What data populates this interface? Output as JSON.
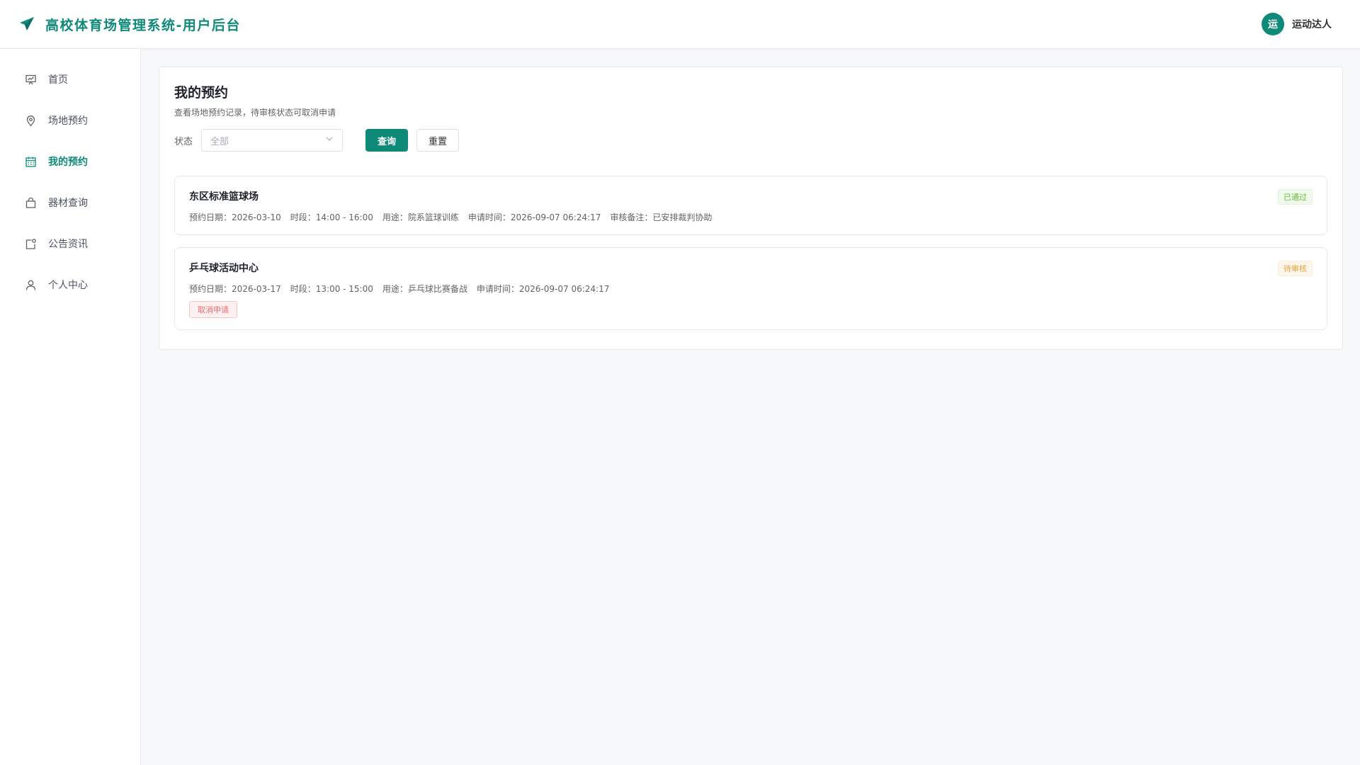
{
  "header": {
    "title": "高校体育场管理系统-用户后台",
    "logo_icon": "paper-plane-icon",
    "user": {
      "avatar_text": "运",
      "name": "运动达人"
    }
  },
  "sidebar": {
    "items": [
      {
        "label": "首页",
        "icon": "presentation-icon",
        "active": false
      },
      {
        "label": "场地预约",
        "icon": "location-pin-icon",
        "active": false
      },
      {
        "label": "我的预约",
        "icon": "calendar-icon",
        "active": true
      },
      {
        "label": "器材查询",
        "icon": "shopping-bag-icon",
        "active": false
      },
      {
        "label": "公告资讯",
        "icon": "notification-icon",
        "active": false
      },
      {
        "label": "个人中心",
        "icon": "user-icon",
        "active": false
      }
    ]
  },
  "main": {
    "title": "我的预约",
    "subtitle": "查看场地预约记录，待审核状态可取消申请",
    "filter": {
      "label": "状态",
      "select_value": "全部",
      "query_label": "查询",
      "reset_label": "重置"
    },
    "bookings": [
      {
        "venue": "东区标准篮球场",
        "status": "已通过",
        "date": "预约日期：2026-03-10",
        "slot": "时段：14:00 - 16:00",
        "purpose": "用途：院系篮球训练",
        "applied": "申请时间：2026-09-07 06:24:17",
        "remark": "审核备注：已安排裁判协助"
      },
      {
        "venue": "乒乓球活动中心",
        "status": "待审核",
        "date": "预约日期：2026-03-17",
        "slot": "时段：13:00 - 15:00",
        "purpose": "用途：乒乓球比赛备战",
        "applied": "申请时间：2026-09-07 06:24:17",
        "cancel_label": "取消申请"
      }
    ]
  },
  "colors": {
    "primary": "#0f8a78",
    "success": "#67c23a",
    "warning": "#e6a23c",
    "danger": "#f56c6c"
  }
}
